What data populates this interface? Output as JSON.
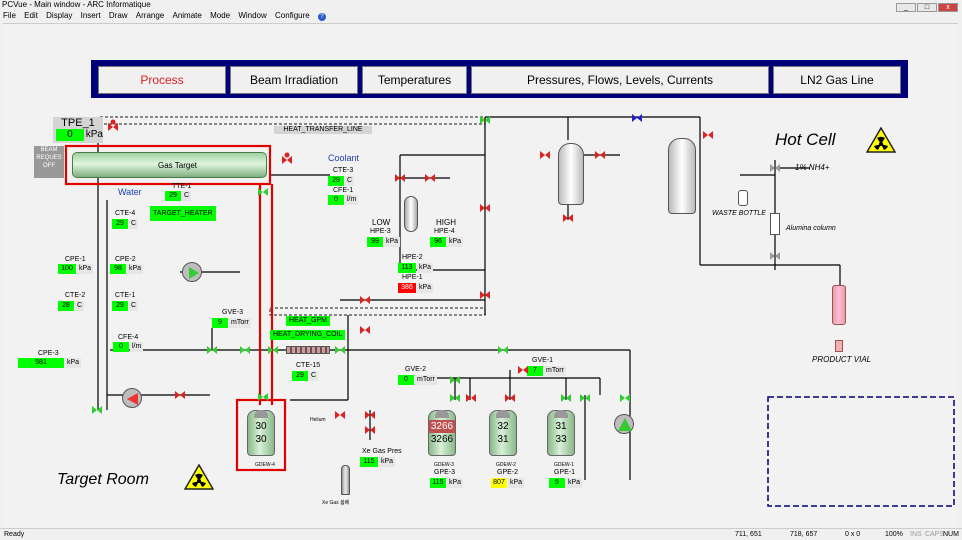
{
  "window": {
    "title": "PCVue - Main window - ARC Informatique"
  },
  "menu": [
    "File",
    "Edit",
    "Display",
    "Insert",
    "Draw",
    "Arrange",
    "Animate",
    "Mode",
    "Window",
    "Configure"
  ],
  "nav": {
    "process": "Process",
    "beam": "Beam Irradiation",
    "temps": "Temperatures",
    "pressures": "Pressures, Flows, Levels, Currents",
    "ln2": "LN2 Gas Line"
  },
  "tpe1": {
    "label": "TPE_1",
    "value": "0",
    "unit": "kPa"
  },
  "beam_request": {
    "line1": "BEAM",
    "line2": "REQUES",
    "state": "OFF"
  },
  "heat_transfer_line": "HEAT_TRANSFER_LINE",
  "gas_target": "Gas Target",
  "coolant": "Coolant",
  "water": "Water",
  "cte3": {
    "label": "CTE-3",
    "value": "29",
    "unit": "C"
  },
  "cfe1": {
    "label": "CFE-1",
    "value": "0",
    "unit": "l/m"
  },
  "tte1": {
    "label": "TTE-1",
    "value": "29",
    "unit": "C"
  },
  "target_heater": "TARGET_HEATER",
  "cte4": {
    "label": "CTE-4",
    "value": "29",
    "unit": "C"
  },
  "cpe1": {
    "label": "CPE-1",
    "value": "100",
    "unit": "kPa"
  },
  "cpe2": {
    "label": "CPE-2",
    "value": "98",
    "unit": "kPa"
  },
  "cte2": {
    "label": "CTE-2",
    "value": "28",
    "unit": "C"
  },
  "cte1": {
    "label": "CTE-1",
    "value": "29",
    "unit": "C"
  },
  "cfe4": {
    "label": "CFE-4",
    "value": "0",
    "unit": "l/m"
  },
  "cpe3": {
    "label": "CPE-3",
    "value": "581",
    "unit": "kPa"
  },
  "gve3": {
    "label": "GVE-3",
    "value": "9",
    "unit": "mTorr"
  },
  "heat_gpm": "HEAT_GPM",
  "heat_drying_coil": "HEAT_DRYING_COIL",
  "cte15": {
    "label": "CTE-15",
    "value": "29",
    "unit": "C"
  },
  "low": {
    "label": "LOW",
    "sub": "HPE-3",
    "value": "99",
    "unit": "kPa"
  },
  "high": {
    "label": "HIGH",
    "sub": "HPE-4",
    "value": "96",
    "unit": "kPa"
  },
  "hpe2": {
    "label": "HPE-2",
    "value": "113",
    "unit": "kPa"
  },
  "hpe1": {
    "label": "HPE-1",
    "value": "386",
    "unit": "kPa"
  },
  "hot_cell": "Hot Cell",
  "target_room": "Target Room",
  "nh4": "1% NH4+",
  "waste_bottle": "WASTE BOTTLE",
  "alumina": "Alumina column",
  "product_vial": "PRODUCT VIAL",
  "gve2": {
    "label": "GVE-2",
    "value": "0",
    "unit": "mTorr"
  },
  "gve1": {
    "label": "GVE-1",
    "value": "7",
    "unit": "mTorr"
  },
  "tank4": {
    "top": "30",
    "bottom": "30",
    "tag": "GDEW-4"
  },
  "tank3": {
    "top": "3266",
    "bottom": "3266",
    "tag": "GDEW-3"
  },
  "tank2": {
    "top": "32",
    "bottom": "31",
    "tag": "GDEW-2"
  },
  "tank1": {
    "top": "31",
    "bottom": "33",
    "tag": "GDEW-1"
  },
  "gpe3": {
    "label": "GPE-3",
    "value": "115",
    "unit": "kPa"
  },
  "gpe2": {
    "label": "GPE-2",
    "value": "807",
    "unit": "kPa"
  },
  "gpe1": {
    "label": "GPE-1",
    "value": "5",
    "unit": "kPa"
  },
  "xe_pres": {
    "label": "Xe Gas Pres",
    "value": "115",
    "unit": "kPa"
  },
  "helium": "Helium",
  "xe_bottle": "Xe Gas 봄베",
  "status": {
    "ready": "Ready",
    "c1": "711, 651",
    "c2": "718, 657",
    "c3": "0 x 0",
    "zoom": "100%",
    "ins": "INS",
    "caps": "CAPS",
    "num": "NUM"
  },
  "colors": {
    "nav_bg": "#00007b",
    "accent": "#e02020",
    "highlight": "#e00000",
    "good": "#00ff00"
  }
}
